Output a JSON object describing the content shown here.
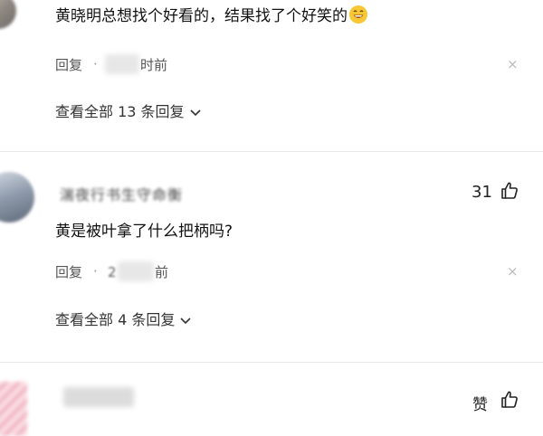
{
  "comment1": {
    "text": "黄晓明总想找个好看的，结果找了个好笑的",
    "emoji": "laughing-face-emoji",
    "reply_label": "回复",
    "separator": "·",
    "time_visible": "时前",
    "view_replies": "查看全部 13 条回复",
    "close_symbol": "×"
  },
  "comment2": {
    "username": "湍夜行书生守命衡",
    "like_count": "31",
    "text": "黄是被叶拿了什么把柄吗?",
    "reply_label": "回复",
    "separator": "·",
    "time_prefix": "2",
    "time_visible": "前",
    "view_replies": "查看全部 4 条回复",
    "close_symbol": "×"
  },
  "comment3": {
    "like_label": "赞"
  },
  "colors": {
    "emoji": "#f7c734",
    "text": "#111111",
    "meta": "#555555"
  }
}
